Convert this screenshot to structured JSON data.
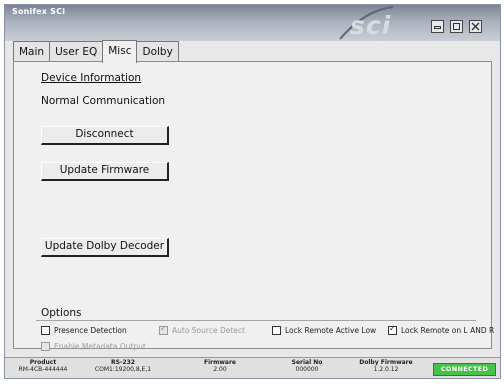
{
  "window": {
    "title": "Sonifex SCI",
    "brand": "sci",
    "controls": [
      "minimize-icon",
      "maximize-icon",
      "close-icon"
    ]
  },
  "tabs": [
    {
      "label": "Main",
      "active": false
    },
    {
      "label": "User EQ",
      "active": false
    },
    {
      "label": "Misc",
      "active": true
    },
    {
      "label": "Dolby",
      "active": false
    }
  ],
  "misc": {
    "device_info_title": "Device Information",
    "status_text": "Normal Communication",
    "disconnect_label": "Disconnect",
    "update_firmware_label": "Update Firmware",
    "update_dolby_label": "Update Dolby Decoder"
  },
  "options": {
    "title": "Options",
    "items": [
      {
        "label": "Presence Detection",
        "checked": false,
        "enabled": true
      },
      {
        "label": "Auto Source Detect",
        "checked": true,
        "enabled": false
      },
      {
        "label": "Lock Remote Active Low",
        "checked": false,
        "enabled": true
      },
      {
        "label": "Lock Remote on L AND R",
        "checked": true,
        "enabled": true
      },
      {
        "label": "Enable Metadata Output",
        "checked": false,
        "enabled": false
      }
    ]
  },
  "statusbar": {
    "product_label": "Product",
    "product_value": "RM-4CB-444444",
    "rs232_label": "RS-232",
    "rs232_value": "COM1:19200,8,E,1",
    "firmware_label": "Firmware",
    "firmware_value": "2.00",
    "serial_label": "Serial No",
    "serial_value": "000000",
    "dolby_fw_label": "Dolby Firmware",
    "dolby_fw_value": "1.2.0.12",
    "connection_status": "CONNECTED",
    "connection_color": "#46c24a"
  }
}
